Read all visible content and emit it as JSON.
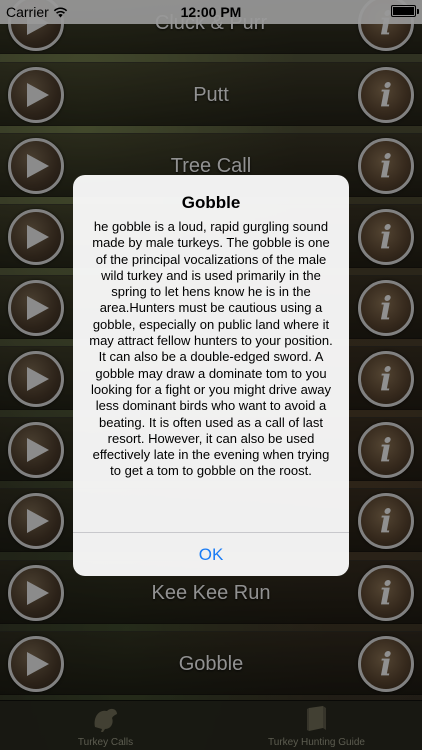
{
  "status_bar": {
    "carrier": "Carrier",
    "time": "12:00 PM"
  },
  "calls": [
    {
      "label": "Cluck & Purr"
    },
    {
      "label": "Putt"
    },
    {
      "label": "Tree Call"
    },
    {
      "label": ""
    },
    {
      "label": ""
    },
    {
      "label": ""
    },
    {
      "label": ""
    },
    {
      "label": ""
    },
    {
      "label": "Kee Kee Run"
    },
    {
      "label": "Gobble"
    }
  ],
  "tab_bar": {
    "tabs": [
      {
        "label": "Turkey Calls",
        "icon": "turkey-icon"
      },
      {
        "label": "Turkey Hunting Guide",
        "icon": "book-icon"
      }
    ]
  },
  "alert": {
    "title": "Gobble",
    "message": "he gobble is a loud, rapid gurgling sound made by male turkeys. The gobble is one of the principal vocalizations of the male wild turkey and is used primarily in the spring to let hens know he is in the area.Hunters must be cautious using a gobble, especially on public land where it may attract fellow hunters to your position. It can also be a double-edged sword. A gobble may draw a dominate tom to you looking for a fight or you might drive away less dominant birds who want to avoid a beating. It is often used as a call of last resort. However, it can also be used effectively late in the evening when trying to get a tom to gobble on the roost.",
    "ok_label": "OK"
  },
  "colors": {
    "accent": "#1a7cf5",
    "alert_bg": "#f8f8f8"
  }
}
